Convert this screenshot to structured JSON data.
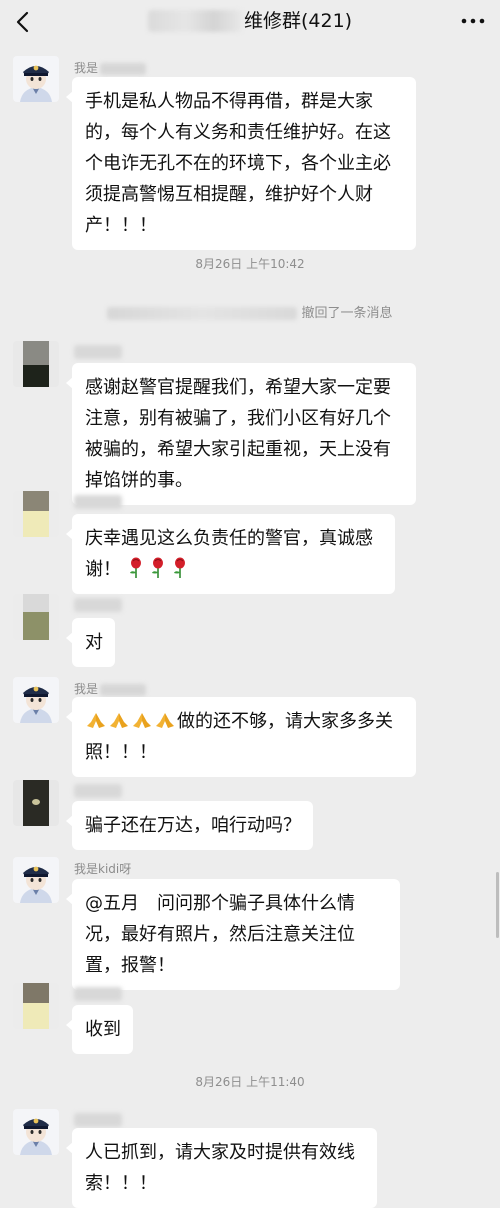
{
  "header": {
    "title": "维修群(421)",
    "back_icon": "chevron-left-icon",
    "more_icon": "more-dots-icon"
  },
  "messages": [
    {
      "sender": "我是",
      "text": "手机是私人物品不得再借，群是大家的，每个人有义务和责任维护好。在这个电诈无孔不在的环境下，各个业主必须提高警惕互相提醒，维护好个人财产！！！"
    },
    {
      "sender": "",
      "text": "感谢赵警官提醒我们，希望大家一定要注意，别有被骗了，我们小区有好几个被骗的，希望大家引起重视，天上没有掉馅饼的事。"
    },
    {
      "sender": "",
      "text": "庆幸遇见这么负责任的警官，真诚感谢！",
      "emoji": "rose-icon"
    },
    {
      "sender": "",
      "text": "对"
    },
    {
      "sender": "我是",
      "text": "做的还不够，请大家多多关照！！！",
      "emoji": "pray-hands-icon"
    },
    {
      "sender": "",
      "text": "骗子还在万达，咱行动吗？"
    },
    {
      "sender": "我是kidi呀",
      "text": "@五月　问问那个骗子具体什么情况，最好有照片，然后注意关注位置，报警！"
    },
    {
      "sender": "",
      "text": "收到"
    },
    {
      "sender": "",
      "text": "人已抓到，请大家及时提供有效线索！！！"
    }
  ],
  "timestamps": [
    "8月26日 上午10:42",
    "8月26日 上午11:40"
  ],
  "recall_notice": "撤回了一条消息",
  "colors": {
    "background": "#ededed",
    "bubble": "#ffffff",
    "meta_text": "#8e8e8e"
  }
}
